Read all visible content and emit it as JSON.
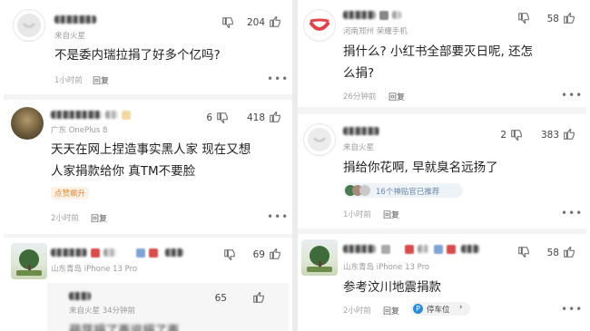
{
  "left": {
    "c1": {
      "location": "来自火星",
      "like_count": "204",
      "text": "不是委内瑞拉捐了好多个亿吗?",
      "time": "1小时前",
      "reply": "回复",
      "more": "•••"
    },
    "c2": {
      "location": "广东 OnePlus 8",
      "dislike_count": "6",
      "like_count": "418",
      "text_line1": "天天在网上捏造事实黑人家 现在又想",
      "text_line2": "人家捐款给你 真TM不要脸",
      "badge": "点赞飙升",
      "time": "2小时前",
      "reply": "回复",
      "more": "•••"
    },
    "c3": {
      "location": "山东青岛  iPhone 13 Pro",
      "like_count": "69",
      "more": "•••",
      "sub": {
        "meta": "来自火星 34分钟前",
        "like_count": "65",
        "text_partial": "萌芽捐了再说捐了再"
      }
    }
  },
  "right": {
    "c1": {
      "location": "河南郑州  荣耀手机",
      "like_count": "58",
      "text_line1": "捐什么? 小红书全部要灭日呢, 还怎",
      "text_line2": "么捐?",
      "time": "26分钟前",
      "reply": "回复",
      "more": "•••"
    },
    "c2": {
      "location": "来自火星",
      "dislike_count": "2",
      "like_count": "383",
      "text": "捐给你花啊, 早就臭名远扬了",
      "hot": "16个神贴官已推荐",
      "time": "1小时前",
      "reply": "回复",
      "more": "•••"
    },
    "c3": {
      "location": "山东青岛  iPhone 13 Pro",
      "like_count": "58",
      "text": "参考汶川地震捐款",
      "time": "2小时前",
      "reply": "回复",
      "parking": "停车位",
      "parking_chevron": "›",
      "more": "•••"
    }
  },
  "colors": {
    "background": "#f4f4f4",
    "card": "#ffffff",
    "text": "#222222",
    "muted": "#9a9a9a",
    "logo_red": "#e0454c",
    "badge_orange": "#e08a3a",
    "parking_blue": "#2f8bd6"
  },
  "icons": [
    "dislike-icon",
    "like-icon",
    "app-logo-icon",
    "parking-icon"
  ]
}
